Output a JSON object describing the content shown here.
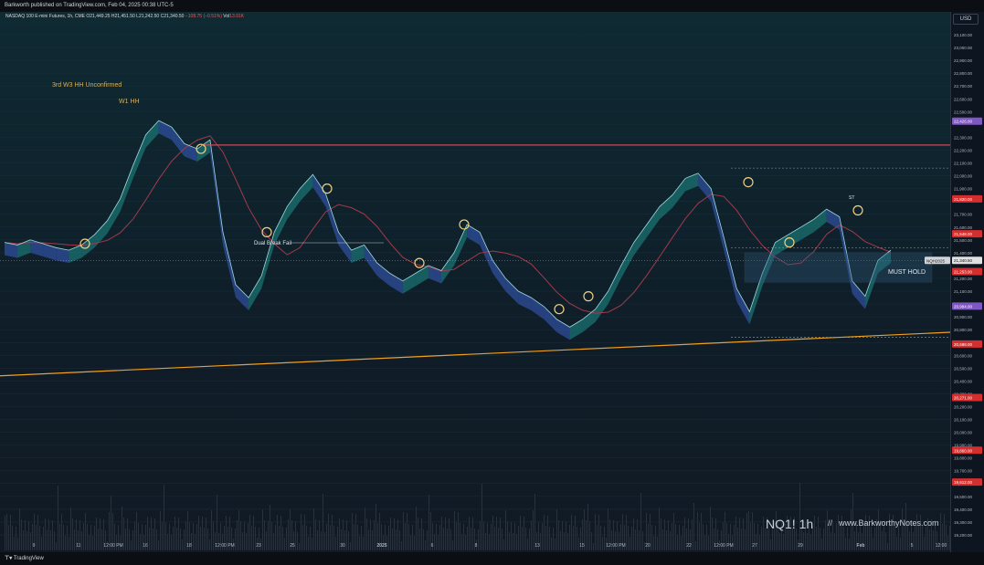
{
  "header": {
    "published_line": "Barkworth published on TradingView.com, Feb 04, 2025 00:38 UTC-5",
    "symbol": "NASDAQ 100 E-mini Futures, 1h, CME",
    "ohlc": {
      "O": "21,449.25",
      "H": "21,451.50",
      "L": "21,242.50",
      "C": "21,340.50",
      "change": "−108.75 (−0.51%)",
      "vol": "13.91K"
    },
    "labels": {
      "o": "O",
      "h": "H",
      "l": "L",
      "c": "C",
      "vol": "Vol"
    }
  },
  "currency": "USD",
  "footer": {
    "brand": "TradingView",
    "brand_icon": "tradingview-logo-icon"
  },
  "watermark": {
    "title": "NQ1! 1h",
    "sep": "//",
    "site": "www.BarkworthyNotes.com"
  },
  "annotations": {
    "wave_label": "3rd W3 HH Unconfirmed",
    "w1_label": "W1 HH",
    "dual_break": "Dual Break Fail",
    "must_hold": "MUST HOLD",
    "st_label": "ST"
  },
  "chart_data": {
    "type": "line",
    "y_ticks": [
      "23,100.00",
      "23,000.00",
      "22,900.00",
      "22,800.00",
      "22,700.00",
      "22,600.00",
      "22,500.00",
      "22,300.00",
      "22,200.00",
      "22,100.00",
      "22,000.00",
      "21,900.00",
      "21,700.00",
      "21,600.00",
      "21,500.00",
      "21,400.00",
      "21,200.00",
      "21,100.00",
      "21,000.00",
      "20,900.00",
      "20,800.00",
      "20,600.00",
      "20,500.00",
      "20,400.00",
      "20,300.00",
      "20,200.00",
      "20,100.00",
      "20,000.00",
      "19,900.00",
      "19,800.00",
      "19,700.00",
      "19,600.00",
      "19,500.00",
      "19,400.00",
      "19,300.00",
      "19,200.00"
    ],
    "y_range": [
      19200,
      23100
    ],
    "x_ticks": [
      "9",
      "11",
      "12:00 PM",
      "16",
      "18",
      "12:00 PM",
      "23",
      "25",
      "30",
      "2025",
      "6",
      "8",
      "13",
      "15",
      "12:00 PM",
      "20",
      "22",
      "12:00 PM",
      "27",
      "29",
      "Feb",
      "5",
      "12:00"
    ],
    "badges": [
      {
        "value": "22,426.00",
        "color": "#7e57c2"
      },
      {
        "value": "21,820.00",
        "color": "#d32f2f"
      },
      {
        "value": "21,548.00",
        "color": "#d32f2f"
      },
      {
        "value": "21,340.50",
        "color": "#e0e0e0"
      },
      {
        "value": "21,253.00",
        "color": "#d32f2f"
      },
      {
        "value": "20,984.00",
        "color": "#7e57c2"
      },
      {
        "value": "20,688.00",
        "color": "#d32f2f"
      },
      {
        "value": "20,271.00",
        "color": "#7e57c2"
      },
      {
        "value": "20,271.00",
        "color": "#d32f2f"
      },
      {
        "value": "19,860.00",
        "color": "#d32f2f"
      },
      {
        "value": "19,612.00",
        "color": "#d32f2f"
      }
    ],
    "symbol_badge": "NQH2025",
    "price_series": [
      21480,
      21460,
      21500,
      21470,
      21440,
      21420,
      21460,
      21540,
      21650,
      21820,
      22080,
      22320,
      22430,
      22380,
      22250,
      22210,
      22280,
      21560,
      21150,
      21050,
      21220,
      21560,
      21760,
      21900,
      22010,
      21860,
      21560,
      21420,
      21460,
      21320,
      21240,
      21180,
      21240,
      21300,
      21260,
      21400,
      21620,
      21560,
      21340,
      21200,
      21100,
      21050,
      20980,
      20880,
      20820,
      20880,
      20960,
      21100,
      21300,
      21480,
      21620,
      21760,
      21850,
      21980,
      22020,
      21900,
      21520,
      21120,
      20940,
      21240,
      21480,
      21540,
      21600,
      21660,
      21740,
      21680,
      21180,
      21060,
      21340,
      21420
    ],
    "series": [
      {
        "values": [
          21480,
          21460,
          21500,
          21470,
          21440,
          21420,
          21460,
          21540,
          21650,
          21820,
          22080,
          22320,
          22430,
          22380,
          22250,
          22210,
          22280,
          21560,
          21150,
          21050,
          21220,
          21560,
          21760,
          21900,
          22010,
          21860,
          21560,
          21420,
          21460,
          21320,
          21240,
          21180,
          21240,
          21300,
          21260,
          21400,
          21620,
          21560,
          21340,
          21200,
          21100,
          21050,
          20980,
          20880,
          20820,
          20880,
          20960,
          21100,
          21300,
          21480,
          21620,
          21760,
          21850,
          21980,
          22020,
          21900,
          21520,
          21120,
          20940,
          21240,
          21480,
          21540,
          21600,
          21660,
          21740,
          21680,
          21180,
          21060,
          21340,
          21420
        ]
      }
    ],
    "levels": {
      "resistance": 22240,
      "support_trend_start": 20440,
      "support_trend_end": 20780
    }
  }
}
